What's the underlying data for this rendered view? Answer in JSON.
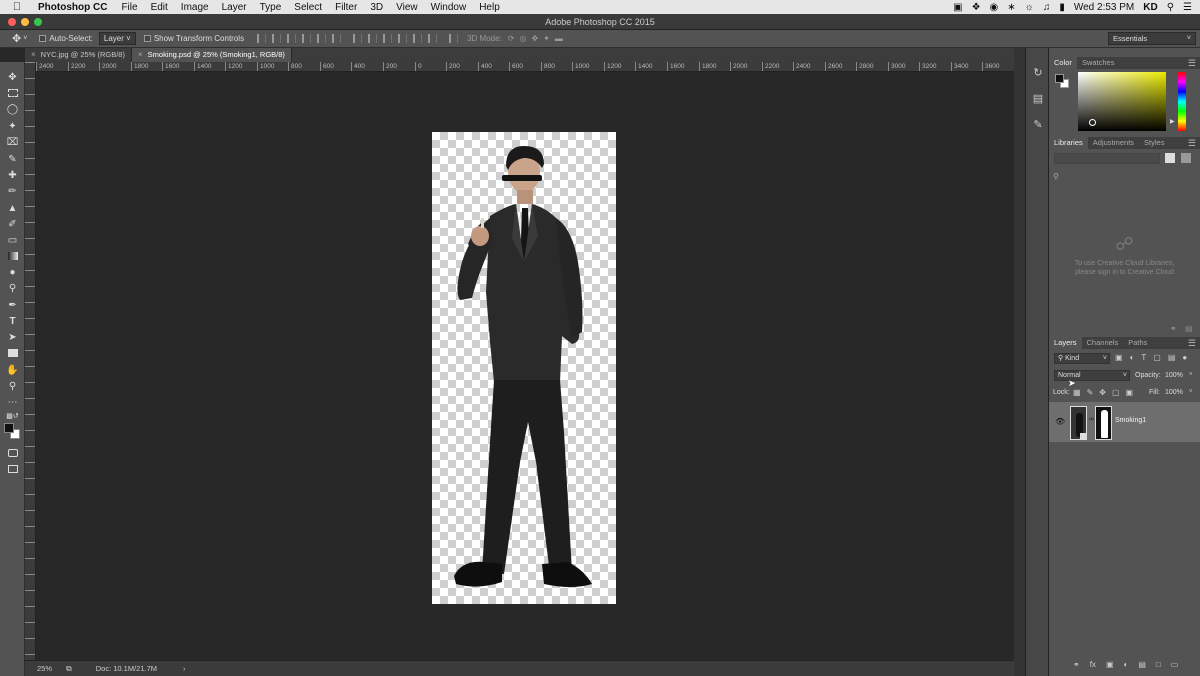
{
  "menubar": {
    "app_name": "Photoshop CC",
    "items": [
      "File",
      "Edit",
      "Image",
      "Layer",
      "Type",
      "Select",
      "Filter",
      "3D",
      "View",
      "Window",
      "Help"
    ],
    "clock": "Wed 2:53 PM",
    "user": "KD"
  },
  "window": {
    "title": "Adobe Photoshop CC 2015"
  },
  "options": {
    "auto_select_label": "Auto-Select:",
    "auto_select_value": "Layer",
    "show_transform_label": "Show Transform Controls",
    "mode_3d_label": "3D Mode:",
    "workspace": "Essentials"
  },
  "tabs": [
    {
      "label": "NYC.jpg @ 25% (RGB/8)",
      "active": false
    },
    {
      "label": "Smoking.psd @ 25% (Smoking1, RGB/8)",
      "active": true
    }
  ],
  "ruler": {
    "h_labels": [
      "2400",
      "2200",
      "2000",
      "1800",
      "1600",
      "1400",
      "1200",
      "1000",
      "800",
      "600",
      "400",
      "200",
      "0",
      "200",
      "400",
      "600",
      "800",
      "1000",
      "1200",
      "1400",
      "1600",
      "1800",
      "2000",
      "2200",
      "2400",
      "2600",
      "2800",
      "3000",
      "3200",
      "3400",
      "3600"
    ]
  },
  "status": {
    "zoom": "25%",
    "doc": "Doc: 10.1M/21.7M"
  },
  "color_panel": {
    "tabs": [
      "Color",
      "Swatches"
    ]
  },
  "libraries_panel": {
    "tabs": [
      "Libraries",
      "Adjustments",
      "Styles"
    ],
    "message_line1": "To use Creative Cloud Libraries,",
    "message_line2": "please sign in to Creative Cloud"
  },
  "layers_panel": {
    "tabs": [
      "Layers",
      "Channels",
      "Paths"
    ],
    "filter_kind": "Kind",
    "blend_mode": "Normal",
    "opacity_label": "Opacity:",
    "opacity_value": "100%",
    "lock_label": "Lock:",
    "fill_label": "Fill:",
    "fill_value": "100%",
    "layer_name": "Smoking1"
  }
}
